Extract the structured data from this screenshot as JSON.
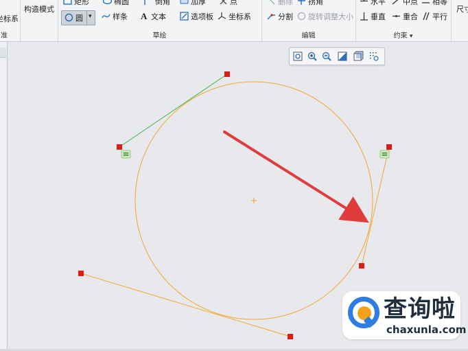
{
  "ribbon": {
    "left_group": {
      "label": "准",
      "item": "坐标系"
    },
    "mode_group": {
      "item": "构造模式"
    },
    "sketch_group": {
      "label": "草绘",
      "row1": [
        "矩形",
        "椭圆",
        "倒角",
        "加厚",
        "点"
      ],
      "circle_button": "圆",
      "row2": [
        "样条",
        "文本",
        "选项板",
        "坐标系"
      ]
    },
    "edit_group": {
      "label": "编辑",
      "row1": [
        "删除",
        "拐角"
      ],
      "row2": [
        "分割",
        "旋转调整大小"
      ]
    },
    "constraint_group": {
      "label": "约束",
      "dropdown_arrow": "▾",
      "row1": [
        "水平",
        "中点",
        "相等"
      ],
      "row2": [
        "垂直",
        "重合",
        "平行"
      ]
    },
    "dimension_group": {
      "item": "尺寸"
    }
  },
  "view_toolbar": {
    "icons": [
      "refit-icon",
      "zoom-in-icon",
      "zoom-out-icon",
      "repaint-icon",
      "display-style-icon",
      "sketch-display-filter-icon"
    ]
  },
  "sketch": {
    "circle_color": "#f3a632",
    "tangent_line_color": "#f3a632",
    "construction_line_color": "#3bb34a",
    "endpoint_color": "#d91e18",
    "arrow_color": "#e03c3c",
    "constraint_symbol": "="
  },
  "watermark": {
    "title": "查询啦",
    "domain": "chaxunla.com"
  }
}
